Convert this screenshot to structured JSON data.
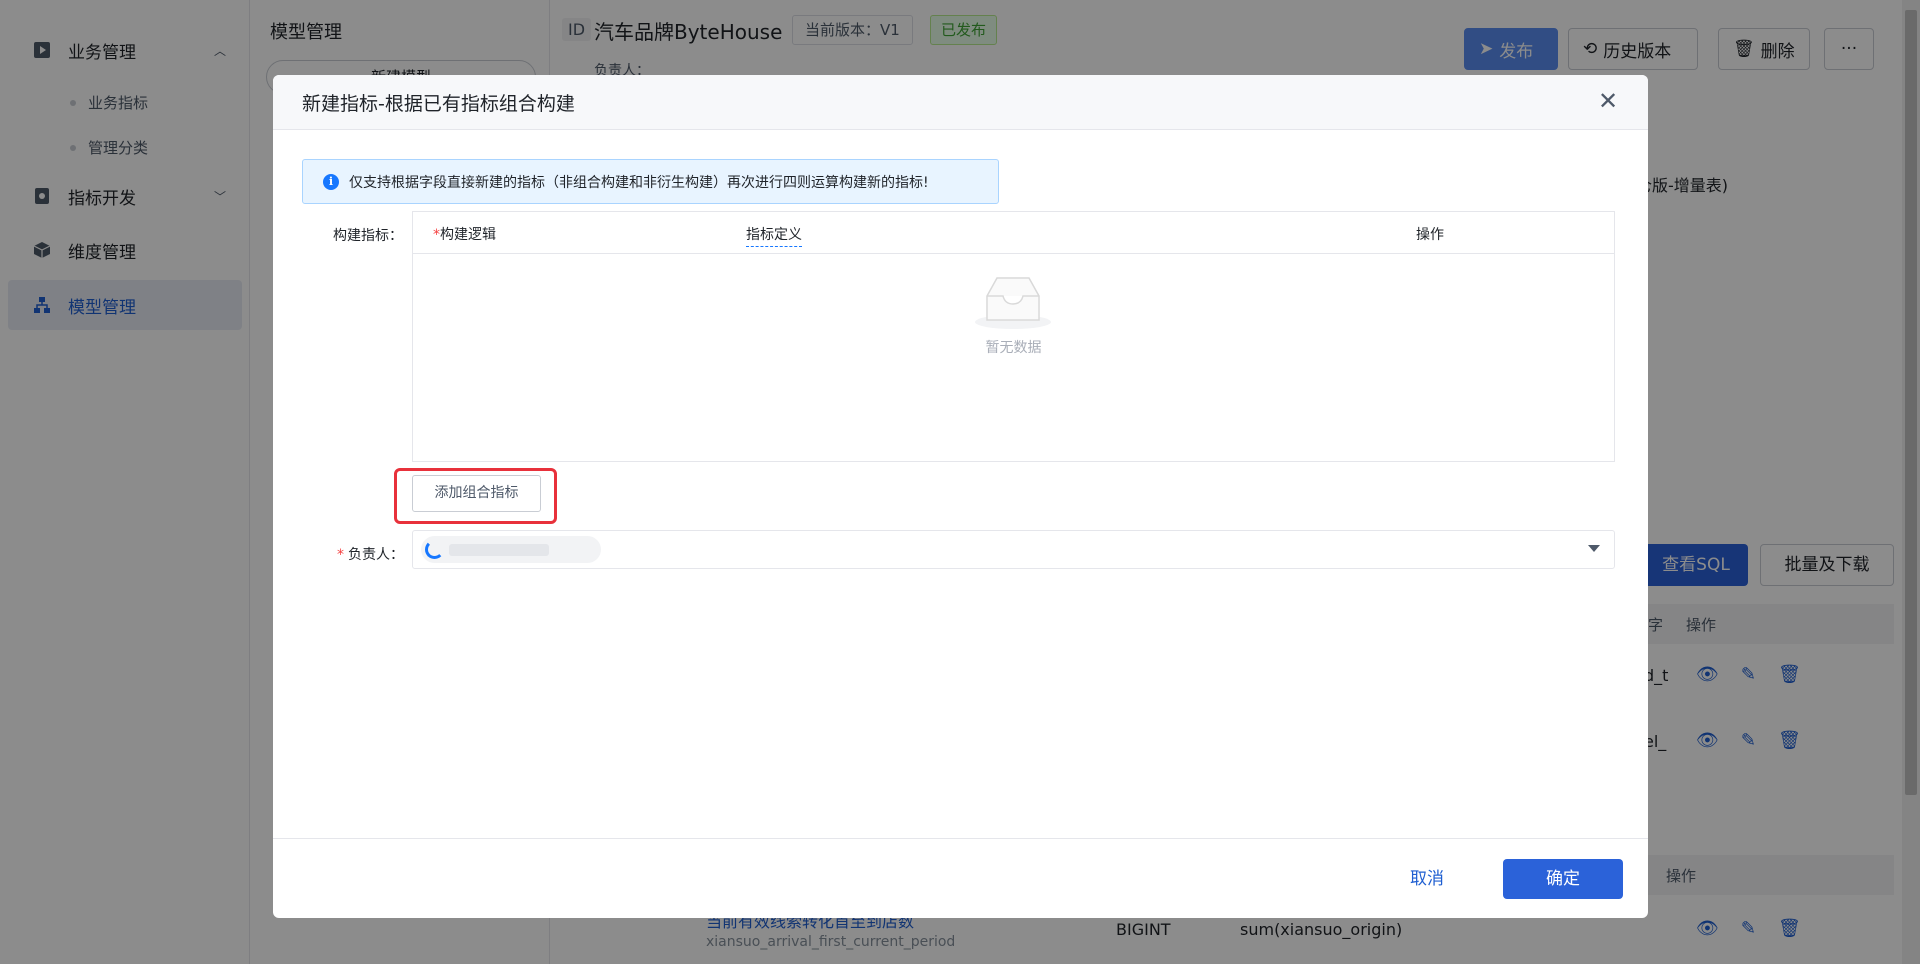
{
  "sidebar": {
    "items": [
      {
        "label": "业务管理",
        "icon": "play-square-icon",
        "chevron": "up"
      },
      {
        "label": "指标开发",
        "icon": "gear-doc-icon",
        "chevron": "down"
      },
      {
        "label": "维度管理",
        "icon": "cube-icon"
      },
      {
        "label": "模型管理",
        "icon": "org-chart-icon",
        "active": true
      }
    ],
    "subitems": [
      "业务指标",
      "管理分类"
    ]
  },
  "tree_panel": {
    "title": "模型管理",
    "new_button": "新建模型"
  },
  "main": {
    "id_tag": "ID",
    "title": "汽车品牌ByteHouse",
    "version_tag": "当前版本：V1",
    "status_tag": "已发布",
    "owner_label": "负责人：",
    "buttons": {
      "publish": "发布",
      "history": "历史版本",
      "delete": "删除",
      "more": "···"
    },
    "partial_text": "仓版-增量表)",
    "view_sql": "查看SQL",
    "batch_download": "批量及下载",
    "col_partial": "字",
    "col_ops": "操作",
    "row_partials": [
      "d_t",
      "el_"
    ],
    "row3": {
      "name_partial": "当前有效线索转化首至到店数",
      "code": "xiansuo_arrival_first_current_period",
      "type": "BIGINT",
      "expr": "sum(xiansuo_origin)"
    }
  },
  "modal": {
    "title": "新建指标-根据已有指标组合构建",
    "alert": "仅支持根据字段直接新建的指标（非组合构建和非衍生构建）再次进行四则运算构建新的指标!",
    "build_label": "构建指标：",
    "table": {
      "columns": [
        "构建逻辑",
        "指标定义",
        "操作"
      ],
      "required_mark": "*",
      "empty_text": "暂无数据"
    },
    "add_button": "添加组合指标",
    "owner_label": "负责人：",
    "cancel": "取消",
    "confirm": "确定"
  }
}
